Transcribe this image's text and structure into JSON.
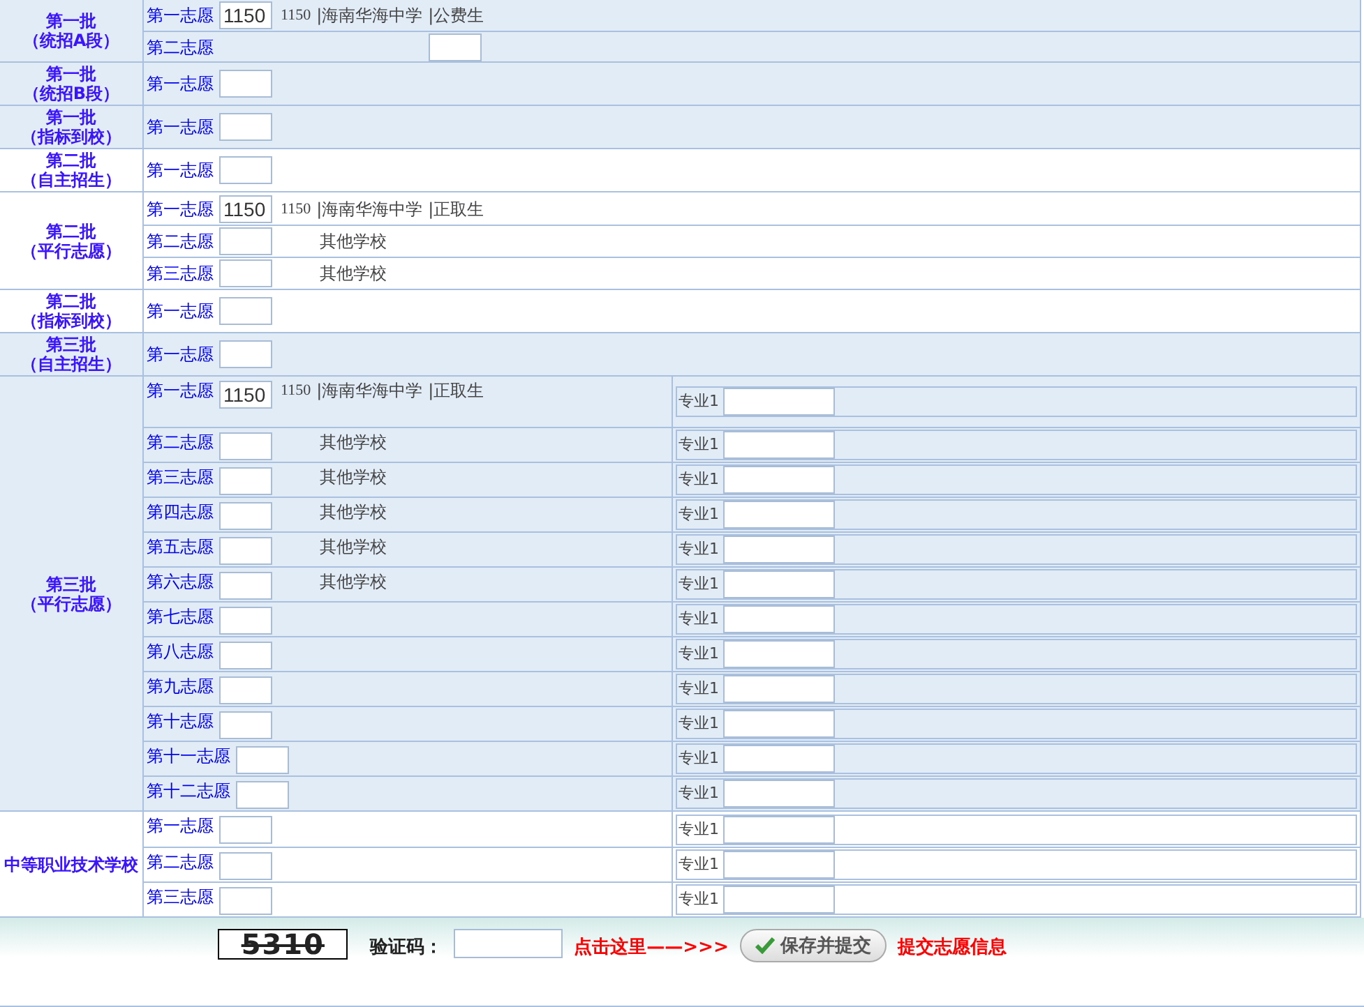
{
  "groups": [
    {
      "title": "第一批",
      "subtitle": "（统招A段）",
      "shaded": true,
      "rows": [
        {
          "label": "第一志愿",
          "value": "1150",
          "code": "1150",
          "school": "|海南华海中学",
          "type": "|公费生"
        },
        {
          "label": "第二志愿",
          "kind": "far"
        }
      ]
    },
    {
      "title": "第一批",
      "subtitle": "（统招B段）",
      "shaded": true,
      "rows": [
        {
          "label": "第一志愿"
        }
      ]
    },
    {
      "title": "第一批",
      "subtitle": "（指标到校）",
      "shaded": true,
      "rows": [
        {
          "label": "第一志愿"
        }
      ]
    },
    {
      "title": "第二批",
      "subtitle": "（自主招生）",
      "shaded": false,
      "rows": [
        {
          "label": "第一志愿"
        }
      ]
    },
    {
      "title": "第二批",
      "subtitle": "（平行志愿）",
      "shaded": false,
      "rows": [
        {
          "label": "第一志愿",
          "value": "1150",
          "code": "1150",
          "school": "|海南华海中学",
          "type": "|正取生"
        },
        {
          "label": "第二志愿",
          "school": "其他学校"
        },
        {
          "label": "第三志愿",
          "school": "其他学校"
        }
      ]
    },
    {
      "title": "第二批",
      "subtitle": "（指标到校）",
      "shaded": false,
      "rows": [
        {
          "label": "第一志愿"
        }
      ]
    },
    {
      "title": "第三批",
      "subtitle": "（自主招生）",
      "shaded": true,
      "rows": [
        {
          "label": "第一志愿"
        }
      ]
    },
    {
      "title": "第三批",
      "subtitle": "（平行志愿）",
      "shaded": true,
      "rows": [
        {
          "label": "第一志愿",
          "value": "1150",
          "code": "1150",
          "school": "|海南华海中学",
          "type": "|正取生",
          "major": "专业1"
        },
        {
          "label": "第二志愿",
          "school": "其他学校",
          "major": "专业1"
        },
        {
          "label": "第三志愿",
          "school": "其他学校",
          "major": "专业1"
        },
        {
          "label": "第四志愿",
          "school": "其他学校",
          "major": "专业1"
        },
        {
          "label": "第五志愿",
          "school": "其他学校",
          "major": "专业1"
        },
        {
          "label": "第六志愿",
          "school": "其他学校",
          "major": "专业1"
        },
        {
          "label": "第七志愿",
          "major": "专业1"
        },
        {
          "label": "第八志愿",
          "major": "专业1"
        },
        {
          "label": "第九志愿",
          "major": "专业1"
        },
        {
          "label": "第十志愿",
          "major": "专业1"
        },
        {
          "label": "第十一志愿",
          "major": "专业1"
        },
        {
          "label": "第十二志愿",
          "major": "专业1"
        }
      ]
    },
    {
      "title": "中等职业技术学校",
      "shaded": false,
      "rows": [
        {
          "label": "第一志愿",
          "major": "专业1"
        },
        {
          "label": "第二志愿",
          "major": "专业1"
        },
        {
          "label": "第三志愿",
          "major": "专业1"
        }
      ]
    }
  ],
  "footer": {
    "captcha": "5310",
    "captcha_label": "验证码：",
    "hint": "点击这里——>>>",
    "button": "保存并提交",
    "note": "提交志愿信息"
  }
}
